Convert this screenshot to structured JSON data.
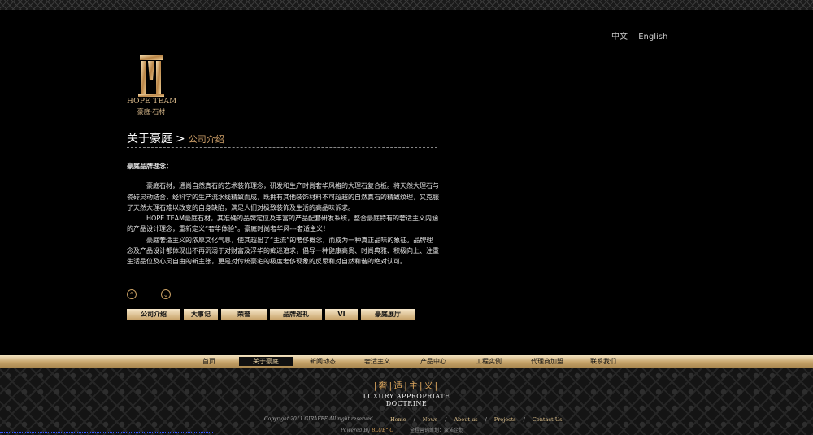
{
  "lang": {
    "zh": "中文",
    "en": "English"
  },
  "logo": {
    "en": "HOPE TEAM",
    "cn": "豪庭·石材"
  },
  "breadcrumb": {
    "parent": "关于豪庭",
    "sep": ">",
    "current": "公司介绍"
  },
  "content": {
    "heading": "豪庭品牌理念：",
    "paragraphs": [
      "豪庭石材，通尚自然真石的艺术装饰理念，研发和生产时尚奢华风格的大理石复合板。将天然大理石与瓷砖灵动结合，经科学的生产流水线精致而成，既拥有其他装饰材料不可超越的自然真石的精致纹理，又克服了天然大理石难以改变的自身缺陷，满足人们对极致装饰及生活的高品味诉求。",
      "HOPE.TEAM豪庭石材，其准确的品牌定位及丰富的产品配套研发系统，整合豪庭特有的奢适主义内涵的产品设计理念，重新定义“奢华体验”。豪庭时尚奢华风---奢适主义！",
      "豪庭奢适主义的浓厚文化气息，使其超出了“主流”的奢侈概念，而成为一种真正品味的象征。品牌理念及产品设计都体现出不再沉溺于对财富及浮华的痴迷追求，倡导一种健康高贵、时尚典雅、积极向上、注重生活品位及心灵自由的新主张，更是对传统豪宅的极度奢侈现象的反思和对自然和谐的绝对认可。"
    ]
  },
  "arrows": {
    "up": "⌃",
    "down": "⌄"
  },
  "subnav": [
    "公司介绍",
    "大事记",
    "荣誉",
    "品牌巡礼",
    "VI",
    "豪庭展厅"
  ],
  "mainnav": [
    "首页",
    "关于豪庭",
    "新闻动态",
    "奢适主义",
    "产品中心",
    "工程实例",
    "代理商加盟",
    "联系我们"
  ],
  "mainnav_active": "关于豪庭",
  "slogan": {
    "cn": "|奢|适|主|义|",
    "en1": "LUXURY APPROPRIATE",
    "en2": "DOCTRINE"
  },
  "footer": {
    "copyright": "Copyright  2011 GIRAFFE  All right reserved",
    "links": [
      "Home",
      "News",
      "About us",
      "Projects",
      "Contact Us"
    ],
    "powered_prefix": "Powered By ",
    "powered_brand": "BLUE° C",
    "powered_extra": "全程营销策划：蒙诺企划"
  },
  "colors": {
    "gold": "#d1a26a",
    "background": "#000000"
  }
}
